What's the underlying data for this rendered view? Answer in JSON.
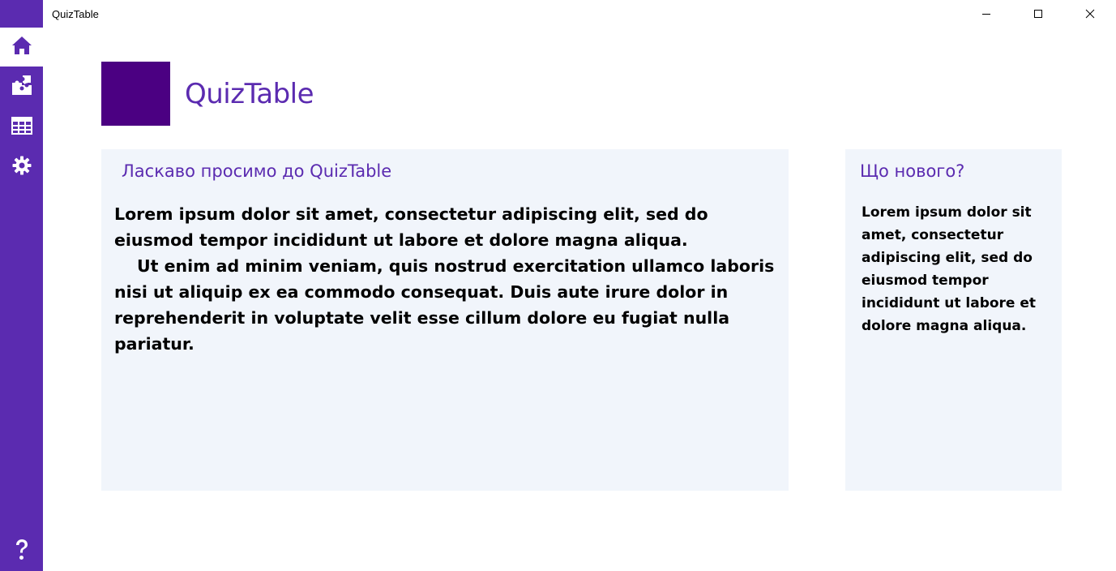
{
  "window": {
    "title": "QuizTable",
    "controls": {
      "minimize_icon": "minimize-icon",
      "maximize_icon": "maximize-icon",
      "close_icon": "close-icon"
    }
  },
  "sidebar": {
    "color": "#5b2bb0",
    "items": [
      {
        "icon": "home-icon",
        "active": true
      },
      {
        "icon": "puzzle-icon",
        "active": false
      },
      {
        "icon": "table-icon",
        "active": false
      },
      {
        "icon": "gear-icon",
        "active": false
      }
    ],
    "bottom_item": {
      "icon": "help-icon",
      "label": "?"
    }
  },
  "header": {
    "logo_color": "#4b0082",
    "title": "QuizTable"
  },
  "welcome": {
    "heading": "Ласкаво просимо до QuizTable",
    "paragraph_1": "Lorem ipsum dolor sit amet, consectetur adipiscing elit, sed do eiusmod tempor incididunt ut labore et dolore magna aliqua.",
    "paragraph_2": "Ut enim ad minim veniam, quis nostrud exercitation ullamco laboris nisi ut aliquip ex ea commodo consequat. Duis aute irure dolor in reprehenderit in voluptate velit esse cillum dolore eu fugiat nulla pariatur."
  },
  "news": {
    "heading": "Що нового?",
    "body": "Lorem ipsum dolor sit amet, consectetur adipiscing elit, sed do eiusmod tempor incididunt ut labore et dolore magna aliqua."
  },
  "colors": {
    "accent": "#5b2bb0",
    "panel_background": "#f1f5fb"
  }
}
